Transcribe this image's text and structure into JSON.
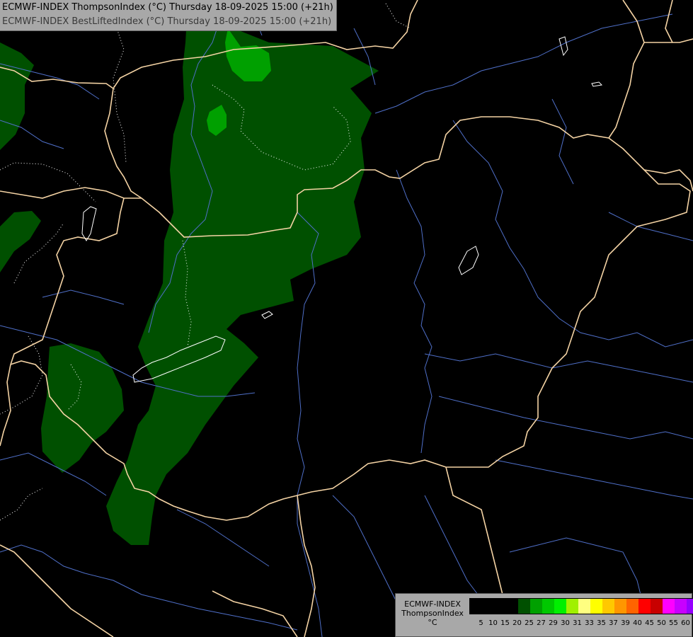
{
  "title": {
    "line1": "ECMWF-INDEX ThompsonIndex (°C) Thursday 18-09-2025 15:00 (+21h)",
    "line2": "ECMWF-INDEX BestLiftedIndex (°C) Thursday 18-09-2025 15:00 (+21h)"
  },
  "legend": {
    "line1": "ECMWF-INDEX",
    "line2": "ThompsonIndex",
    "unit": "°C",
    "colors": [
      "#000000",
      "#000000",
      "#000000",
      "#000000",
      "#005000",
      "#00a000",
      "#00c800",
      "#00f000",
      "#a0f000",
      "#ffff80",
      "#ffff00",
      "#ffc800",
      "#ff9600",
      "#ff6400",
      "#ff0000",
      "#c80000",
      "#ff00ff",
      "#c800ff",
      "#9600ff",
      "#6400ff",
      "#0000ff"
    ],
    "ticks": [
      "5",
      "10",
      "15",
      "20",
      "25",
      "27",
      "29",
      "30",
      "31",
      "33",
      "35",
      "37",
      "39",
      "40",
      "45",
      "50",
      "55",
      "60"
    ]
  },
  "map": {
    "background": "#000000",
    "field_colors": {
      "band_20_25": "#005000",
      "band_25_27": "#00a000"
    },
    "border_color": "#f4d3a4",
    "river_color": "#4f6fc8",
    "lake_outline": "#ffffff"
  }
}
